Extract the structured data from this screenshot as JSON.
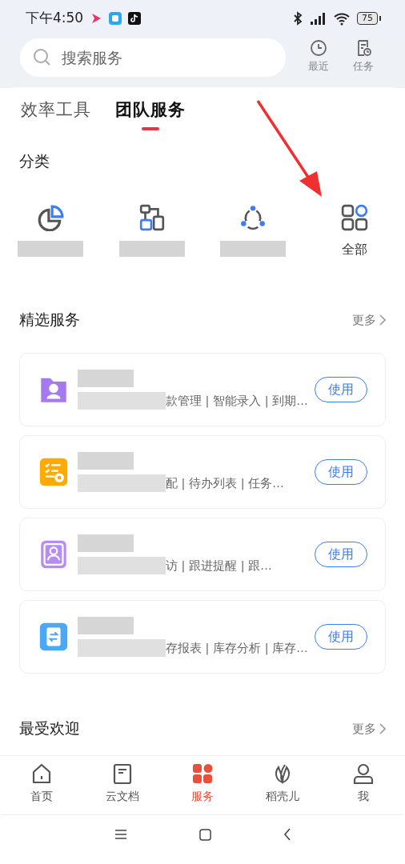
{
  "status_bar": {
    "time": "下午4:50",
    "battery": "75"
  },
  "search": {
    "placeholder": "搜索服务"
  },
  "header_actions": [
    {
      "kind": "clock",
      "label": "最近"
    },
    {
      "kind": "task",
      "label": "任务"
    }
  ],
  "tabs": [
    {
      "label": "效率工具",
      "selected": false
    },
    {
      "label": "团队服务",
      "selected": true
    }
  ],
  "categories": {
    "title": "分类",
    "items": [
      {
        "kind": "pie"
      },
      {
        "kind": "flow"
      },
      {
        "kind": "share"
      },
      {
        "kind": "grid",
        "label": "全部"
      }
    ]
  },
  "featured": {
    "title": "精选服务",
    "more": "更多",
    "cards": [
      {
        "kind": "folder",
        "color": "#a57af0",
        "description": "款管理 | 智能录入 | 到期…",
        "button": "使用"
      },
      {
        "kind": "checklist",
        "color": "#ffaa00",
        "description": "配 | 待办列表 | 任务…",
        "button": "使用"
      },
      {
        "kind": "contacts",
        "color": "#b58cf5",
        "description": "访 | 跟进提醒 | 跟…",
        "button": "使用"
      },
      {
        "kind": "clipboard",
        "color": "#4aa8f5",
        "description": "存报表 | 库存分析 | 库存…",
        "button": "使用"
      }
    ]
  },
  "popular": {
    "title": "最受欢迎",
    "more": "更多"
  },
  "nav": [
    {
      "kind": "home",
      "label": "首页",
      "selected": false
    },
    {
      "kind": "doc",
      "label": "云文档",
      "selected": false
    },
    {
      "kind": "apps",
      "label": "服务",
      "selected": true
    },
    {
      "kind": "leaf",
      "label": "稻壳儿",
      "selected": false
    },
    {
      "kind": "person",
      "label": "我",
      "selected": false
    }
  ]
}
